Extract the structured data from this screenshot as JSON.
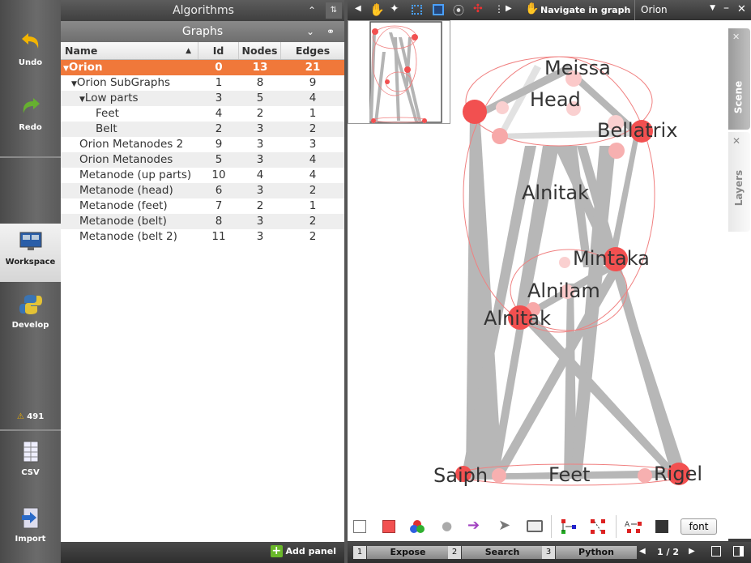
{
  "left_sidebar": {
    "undo": "Undo",
    "redo": "Redo",
    "workspace": "Workspace",
    "develop": "Develop",
    "warnings": "491",
    "csv": "CSV",
    "import": "Import"
  },
  "panels": {
    "algorithms_title": "Algorithms",
    "graphs_title": "Graphs",
    "add_panel": "Add panel"
  },
  "table": {
    "headers": [
      "Name",
      "Id",
      "Nodes",
      "Edges"
    ],
    "rows": [
      {
        "name": "Orion",
        "id": "0",
        "nodes": "13",
        "edges": "21"
      },
      {
        "name": "Orion SubGraphs",
        "id": "1",
        "nodes": "8",
        "edges": "9"
      },
      {
        "name": "Low parts",
        "id": "3",
        "nodes": "5",
        "edges": "4"
      },
      {
        "name": "Feet",
        "id": "4",
        "nodes": "2",
        "edges": "1"
      },
      {
        "name": "Belt",
        "id": "2",
        "nodes": "3",
        "edges": "2"
      },
      {
        "name": "Orion Metanodes 2",
        "id": "9",
        "nodes": "3",
        "edges": "3"
      },
      {
        "name": "Orion Metanodes",
        "id": "5",
        "nodes": "3",
        "edges": "4"
      },
      {
        "name": "Metanode (up parts)",
        "id": "10",
        "nodes": "4",
        "edges": "4"
      },
      {
        "name": "Metanode (head)",
        "id": "6",
        "nodes": "3",
        "edges": "2"
      },
      {
        "name": "Metanode (feet)",
        "id": "7",
        "nodes": "2",
        "edges": "1"
      },
      {
        "name": "Metanode (belt)",
        "id": "8",
        "nodes": "3",
        "edges": "2"
      },
      {
        "name": "Metanode (belt 2)",
        "id": "11",
        "nodes": "3",
        "edges": "2"
      }
    ]
  },
  "toolbar": {
    "mode_label": "Navigate in graph",
    "graph_selector": "Orion"
  },
  "side_tabs": {
    "scene": "Scene",
    "layers": "Layers"
  },
  "graph_labels": {
    "meissa": "Meissa",
    "head": "Head",
    "bellatrix": "Bellatrix",
    "alnitak_top": "Alnitak",
    "mintaka": "Mintaka",
    "alnilam": "Alnilam",
    "alnitak": "Alnitak",
    "saiph": "Saiph",
    "feet": "Feet",
    "rigel": "Rigel"
  },
  "bottom_tools": {
    "font_button": "font"
  },
  "status": {
    "tab1_num": "1",
    "tab1": "Expose",
    "tab2_num": "2",
    "tab2": "Search",
    "tab3_num": "3",
    "tab3": "Python",
    "page": "1 / 2"
  },
  "colors": {
    "selection": "#f0783a",
    "node": "#f25050",
    "edge": "#b4b4b4"
  }
}
